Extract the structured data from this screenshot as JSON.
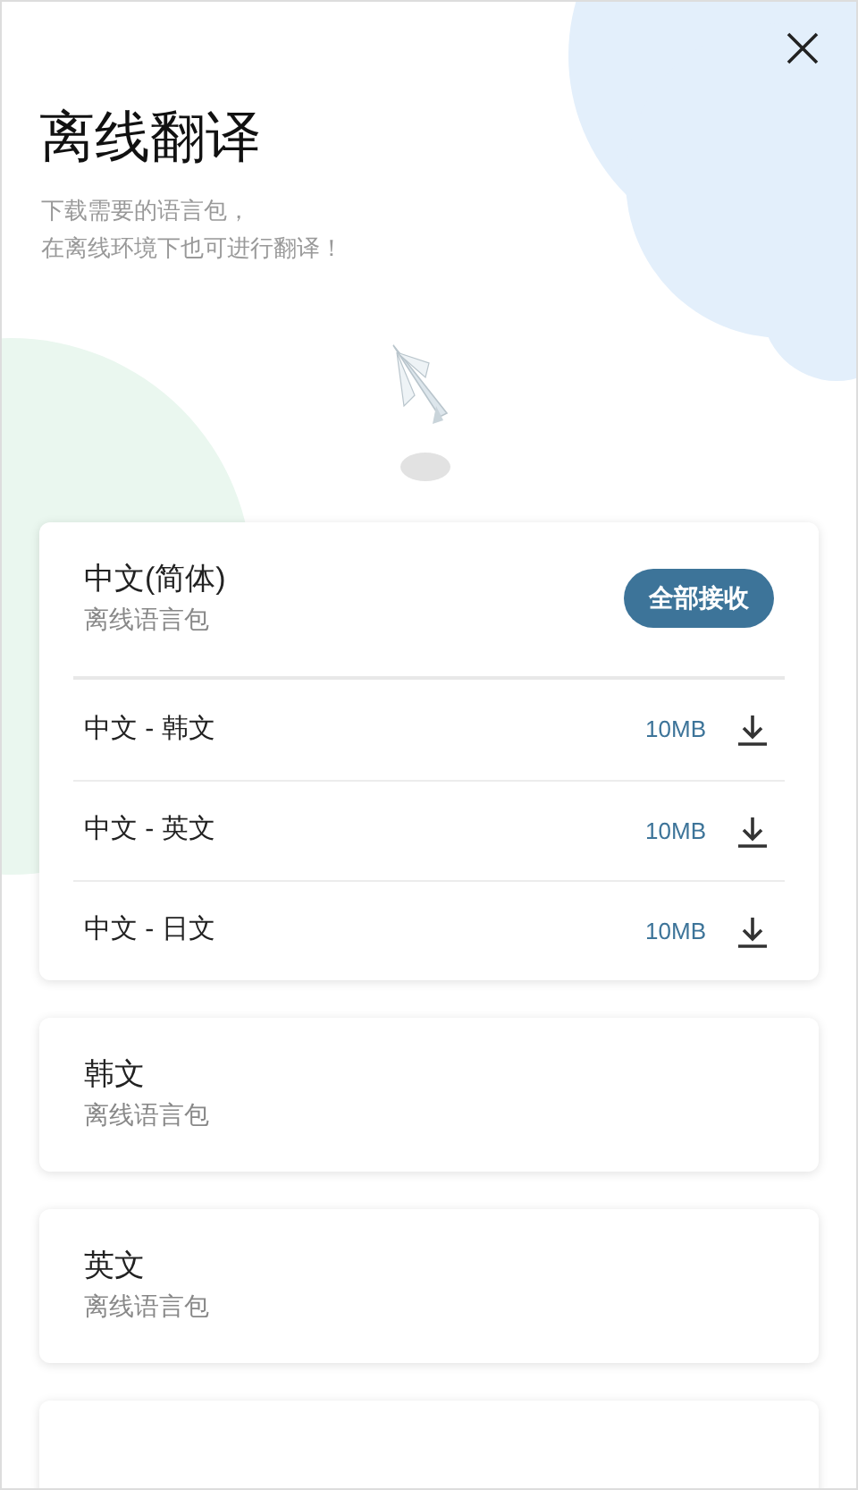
{
  "title": "离线翻译",
  "subtitle_lines": [
    "下载需要的语言包，",
    "在离线环境下也可进行翻译！"
  ],
  "languages": [
    {
      "kind": "group",
      "name": "中文(简体)",
      "caption": "离线语言包",
      "action": "全部接收",
      "packs": [
        {
          "name": "中文 - 韩文",
          "size": "10MB"
        },
        {
          "name": "中文 - 英文",
          "size": "10MB"
        },
        {
          "name": "中文 - 日文",
          "size": "10MB"
        }
      ]
    },
    {
      "kind": "language",
      "name": "韩文",
      "caption": "离线语言包"
    },
    {
      "kind": "language",
      "name": "英文",
      "caption": "离线语言包"
    },
    {
      "kind": "blank"
    }
  ]
}
